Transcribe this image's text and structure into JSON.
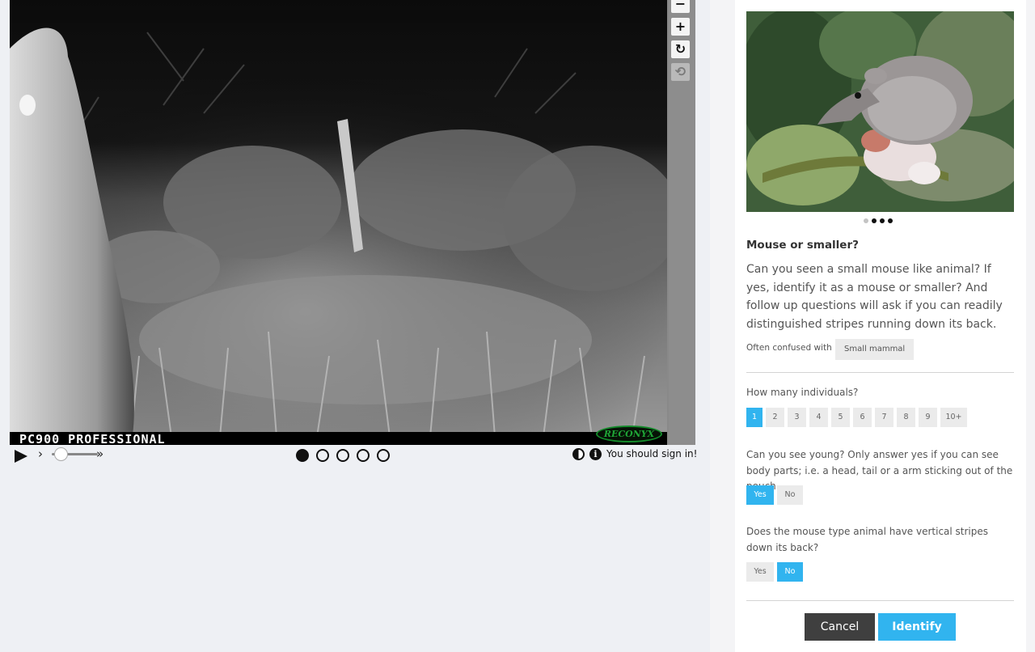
{
  "viewer": {
    "camera_stamp": "PC900 PROFESSIONAL",
    "brand_logo": "RECONYX",
    "zoom_controls": [
      {
        "icon": "zoom-out-icon",
        "glyph": "−"
      },
      {
        "icon": "zoom-in-icon",
        "glyph": "+"
      },
      {
        "icon": "rotate-icon",
        "glyph": "↻"
      },
      {
        "icon": "reset-icon",
        "glyph": "⟲"
      }
    ]
  },
  "controls": {
    "play_glyph": "▶",
    "speed_slow_glyph": "›",
    "speed_fast_glyph": "»",
    "speed_level": 0.2,
    "frames": 5,
    "active_frame": 1,
    "info_glyph": "i",
    "signin_text": "You should sign in!"
  },
  "panel": {
    "carousel_dots": 4,
    "carousel_active": 2,
    "species_title": "Mouse or smaller?",
    "species_description": "Can you seen a small mouse like animal? If yes, identify it as a mouse or smaller? And follow up questions will ask if you can readily distinguished stripes running down its back.",
    "confused_label": "Often confused with",
    "confused_chip": "Small mammal",
    "q1": {
      "label": "How many individuals?",
      "options": [
        "1",
        "2",
        "3",
        "4",
        "5",
        "6",
        "7",
        "8",
        "9",
        "10+"
      ],
      "selected": "1"
    },
    "q2": {
      "label": "Can you see young? Only answer yes if you can see body parts; i.e. a head, tail or a arm sticking out of the pouch.",
      "options": [
        "Yes",
        "No"
      ],
      "selected": "Yes"
    },
    "q3": {
      "label": "Does the mouse type animal have vertical stripes down its back?",
      "options": [
        "Yes",
        "No"
      ],
      "selected": "No"
    },
    "cancel_label": "Cancel",
    "identify_label": "Identify"
  },
  "colors": {
    "accent": "#31b4ef",
    "cancel": "#3f3f3f",
    "background": "#eef0f4"
  }
}
